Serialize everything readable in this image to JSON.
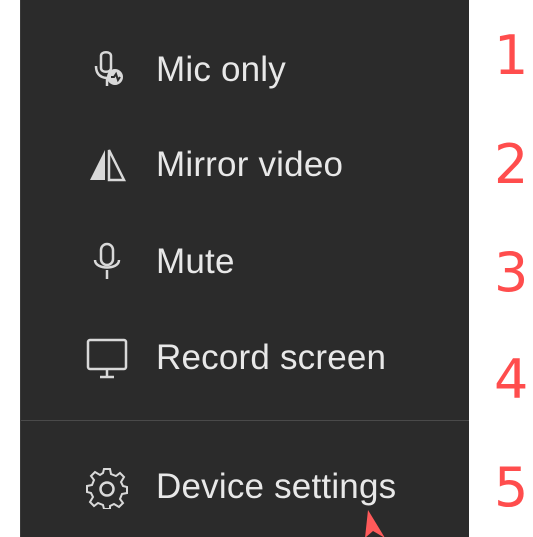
{
  "menu": {
    "items": [
      {
        "label": "Mic only",
        "icon": "mic-only-icon"
      },
      {
        "label": "Mirror video",
        "icon": "mirror-icon"
      },
      {
        "label": "Mute",
        "icon": "microphone-icon"
      },
      {
        "label": "Record screen",
        "icon": "monitor-icon"
      },
      {
        "label": "Device settings",
        "icon": "gear-icon"
      }
    ]
  },
  "annotations": {
    "numbers": [
      "1",
      "2",
      "3",
      "4",
      "5"
    ],
    "color": "#ff4d4d"
  },
  "colors": {
    "menu_background": "#2b2b2b",
    "text": "#e8e8e8",
    "divider": "#4a4a4a",
    "cursor": "#ff5a5a"
  }
}
